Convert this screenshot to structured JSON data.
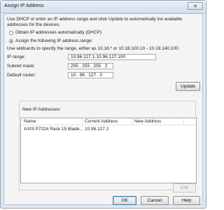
{
  "window": {
    "title": "Assign IP Address",
    "close_glyph": "✕"
  },
  "intro": {
    "line1": "Use DHCP or enter an IP address range and click Update to automatically list available",
    "line2": "addresses for the devices."
  },
  "options": {
    "dhcp_label": "Obtain IP addresses automatically (DHCP)",
    "assign_label": "Assign the following IP address range:",
    "selected": "assign"
  },
  "wildcard_hint": "Use wildcards to specify the range, either as 10.18.* or 10.18.100.10 - 10.18.140.100.",
  "fields": {
    "ip_range_label": "IP range:",
    "ip_range_value": "10.96.127.1-10.96.127.100",
    "subnet_label": "Subnet mask:",
    "subnet_value": "255 . 255 . 255 .   2",
    "router_label": "Default router:",
    "router_value": "10  . 96  . 127 .   0"
  },
  "buttons": {
    "update": "Update",
    "edit": "Edit",
    "ok": "OK",
    "cancel": "Cancel",
    "help": "Help"
  },
  "new_ips": {
    "group_label": "New IP Addresses:",
    "columns": [
      "Name",
      "Current Address",
      "New Address"
    ],
    "rows": [
      {
        "name": "AXIS P7224 Rack 15 Blade...",
        "current": "10.96.127.2",
        "new": ""
      }
    ]
  },
  "colors": {
    "accent": "#3c7fb1",
    "window_frame": "#dfe8f3"
  },
  "icons": {
    "close": "close-icon",
    "radio": "radio-button"
  }
}
